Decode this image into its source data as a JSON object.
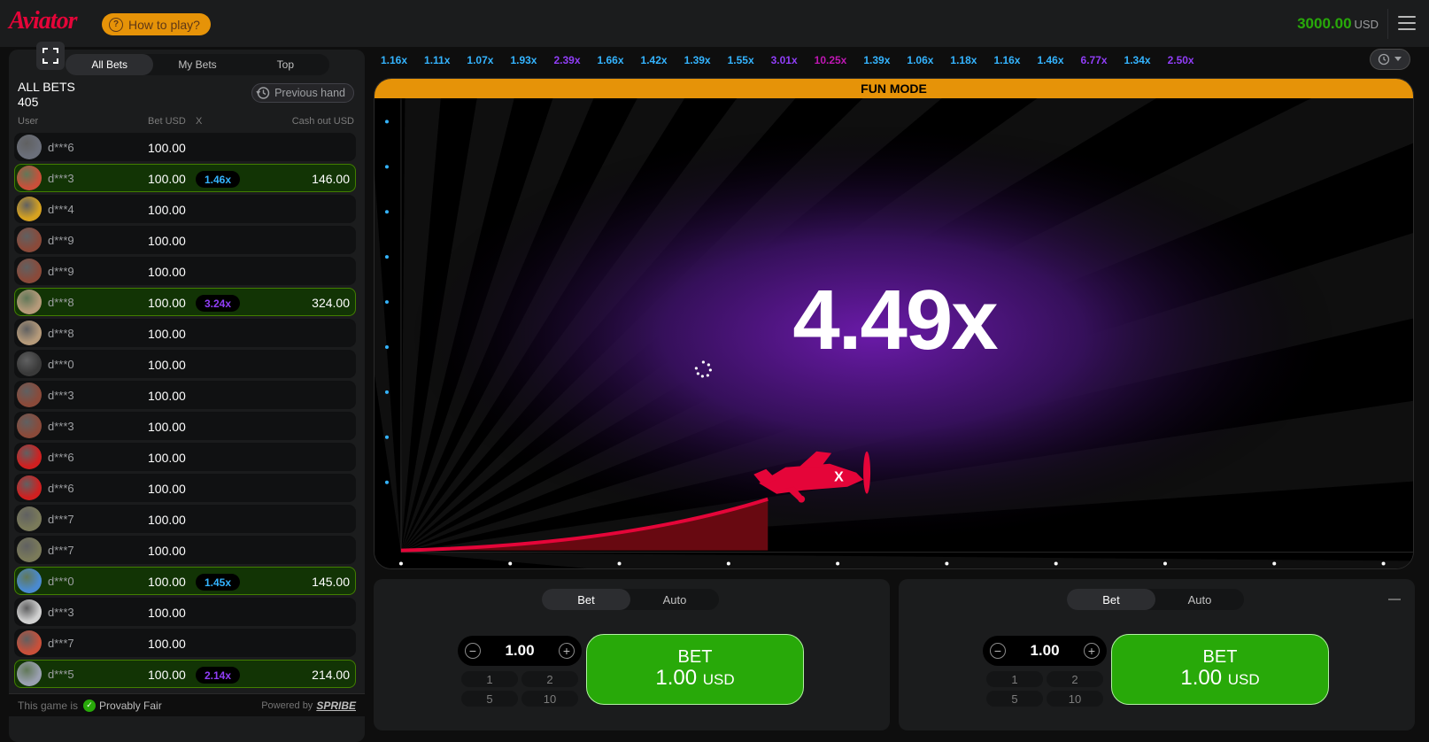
{
  "header": {
    "logo": "Aviator",
    "how_to_play": "How to play?",
    "balance": "3000.00",
    "currency": "USD"
  },
  "bets_panel": {
    "tabs": [
      "All Bets",
      "My Bets",
      "Top"
    ],
    "title": "ALL BETS",
    "count": "405",
    "previous_hand": "Previous hand",
    "columns": {
      "user": "User",
      "bet": "Bet USD",
      "x": "X",
      "cashout": "Cash out USD"
    },
    "rows": [
      {
        "user": "d***6",
        "bet": "100.00",
        "mult": "",
        "cashout": "",
        "win": false,
        "avatar": "#6b6f7a"
      },
      {
        "user": "d***3",
        "bet": "100.00",
        "mult": "1.46x",
        "cashout": "146.00",
        "win": true,
        "avatar": "#c9503a",
        "mult_color": "#34b4ff"
      },
      {
        "user": "d***4",
        "bet": "100.00",
        "mult": "",
        "cashout": "",
        "win": false,
        "avatar": "#d6a220"
      },
      {
        "user": "d***9",
        "bet": "100.00",
        "mult": "",
        "cashout": "",
        "win": false,
        "avatar": "#8a4a3a"
      },
      {
        "user": "d***9",
        "bet": "100.00",
        "mult": "",
        "cashout": "",
        "win": false,
        "avatar": "#8a4a3a"
      },
      {
        "user": "d***8",
        "bet": "100.00",
        "mult": "3.24x",
        "cashout": "324.00",
        "win": true,
        "avatar": "#b59a7a",
        "mult_color": "#913ef8"
      },
      {
        "user": "d***8",
        "bet": "100.00",
        "mult": "",
        "cashout": "",
        "win": false,
        "avatar": "#b59a7a"
      },
      {
        "user": "d***0",
        "bet": "100.00",
        "mult": "",
        "cashout": "",
        "win": false,
        "avatar": "#3a3a3a"
      },
      {
        "user": "d***3",
        "bet": "100.00",
        "mult": "",
        "cashout": "",
        "win": false,
        "avatar": "#8a4a3a"
      },
      {
        "user": "d***3",
        "bet": "100.00",
        "mult": "",
        "cashout": "",
        "win": false,
        "avatar": "#8a4a3a"
      },
      {
        "user": "d***6",
        "bet": "100.00",
        "mult": "",
        "cashout": "",
        "win": false,
        "avatar": "#d02020"
      },
      {
        "user": "d***6",
        "bet": "100.00",
        "mult": "",
        "cashout": "",
        "win": false,
        "avatar": "#d02020"
      },
      {
        "user": "d***7",
        "bet": "100.00",
        "mult": "",
        "cashout": "",
        "win": false,
        "avatar": "#7a7a5a"
      },
      {
        "user": "d***7",
        "bet": "100.00",
        "mult": "",
        "cashout": "",
        "win": false,
        "avatar": "#7a7a5a"
      },
      {
        "user": "d***0",
        "bet": "100.00",
        "mult": "1.45x",
        "cashout": "145.00",
        "win": true,
        "avatar": "#4a8ad0",
        "mult_color": "#34b4ff"
      },
      {
        "user": "d***3",
        "bet": "100.00",
        "mult": "",
        "cashout": "",
        "win": false,
        "avatar": "#d0d0d0"
      },
      {
        "user": "d***7",
        "bet": "100.00",
        "mult": "",
        "cashout": "",
        "win": false,
        "avatar": "#c9503a"
      },
      {
        "user": "d***5",
        "bet": "100.00",
        "mult": "2.14x",
        "cashout": "214.00",
        "win": true,
        "avatar": "#9aa0b0",
        "mult_color": "#913ef8"
      }
    ],
    "footer": {
      "this_game_is": "This game is",
      "provably_fair": "Provably Fair",
      "powered_by": "Powered by",
      "brand": "SPRIBE"
    }
  },
  "history": [
    {
      "v": "1.16x",
      "c": "#34b4ff"
    },
    {
      "v": "1.11x",
      "c": "#34b4ff"
    },
    {
      "v": "1.07x",
      "c": "#34b4ff"
    },
    {
      "v": "1.93x",
      "c": "#34b4ff"
    },
    {
      "v": "2.39x",
      "c": "#913ef8"
    },
    {
      "v": "1.66x",
      "c": "#34b4ff"
    },
    {
      "v": "1.42x",
      "c": "#34b4ff"
    },
    {
      "v": "1.39x",
      "c": "#34b4ff"
    },
    {
      "v": "1.55x",
      "c": "#34b4ff"
    },
    {
      "v": "3.01x",
      "c": "#913ef8"
    },
    {
      "v": "10.25x",
      "c": "#c017b4"
    },
    {
      "v": "1.39x",
      "c": "#34b4ff"
    },
    {
      "v": "1.06x",
      "c": "#34b4ff"
    },
    {
      "v": "1.18x",
      "c": "#34b4ff"
    },
    {
      "v": "1.16x",
      "c": "#34b4ff"
    },
    {
      "v": "1.46x",
      "c": "#34b4ff"
    },
    {
      "v": "6.77x",
      "c": "#913ef8"
    },
    {
      "v": "1.34x",
      "c": "#34b4ff"
    },
    {
      "v": "2.50x",
      "c": "#913ef8"
    }
  ],
  "game": {
    "mode_banner": "FUN MODE",
    "multiplier": "4.49x"
  },
  "bet_panels": [
    {
      "tabs": [
        "Bet",
        "Auto"
      ],
      "stake": "1.00",
      "quick": [
        "1",
        "2",
        "5",
        "10"
      ],
      "button_line1": "BET",
      "button_amount": "1.00",
      "button_currency": "USD"
    },
    {
      "tabs": [
        "Bet",
        "Auto"
      ],
      "stake": "1.00",
      "quick": [
        "1",
        "2",
        "5",
        "10"
      ],
      "button_line1": "BET",
      "button_amount": "1.00",
      "button_currency": "USD"
    }
  ],
  "colors": {
    "accent_red": "#e50539",
    "green": "#28a909",
    "orange": "#e69308",
    "blue_mult": "#34b4ff",
    "purple_mult": "#913ef8",
    "magenta_mult": "#c017b4"
  }
}
